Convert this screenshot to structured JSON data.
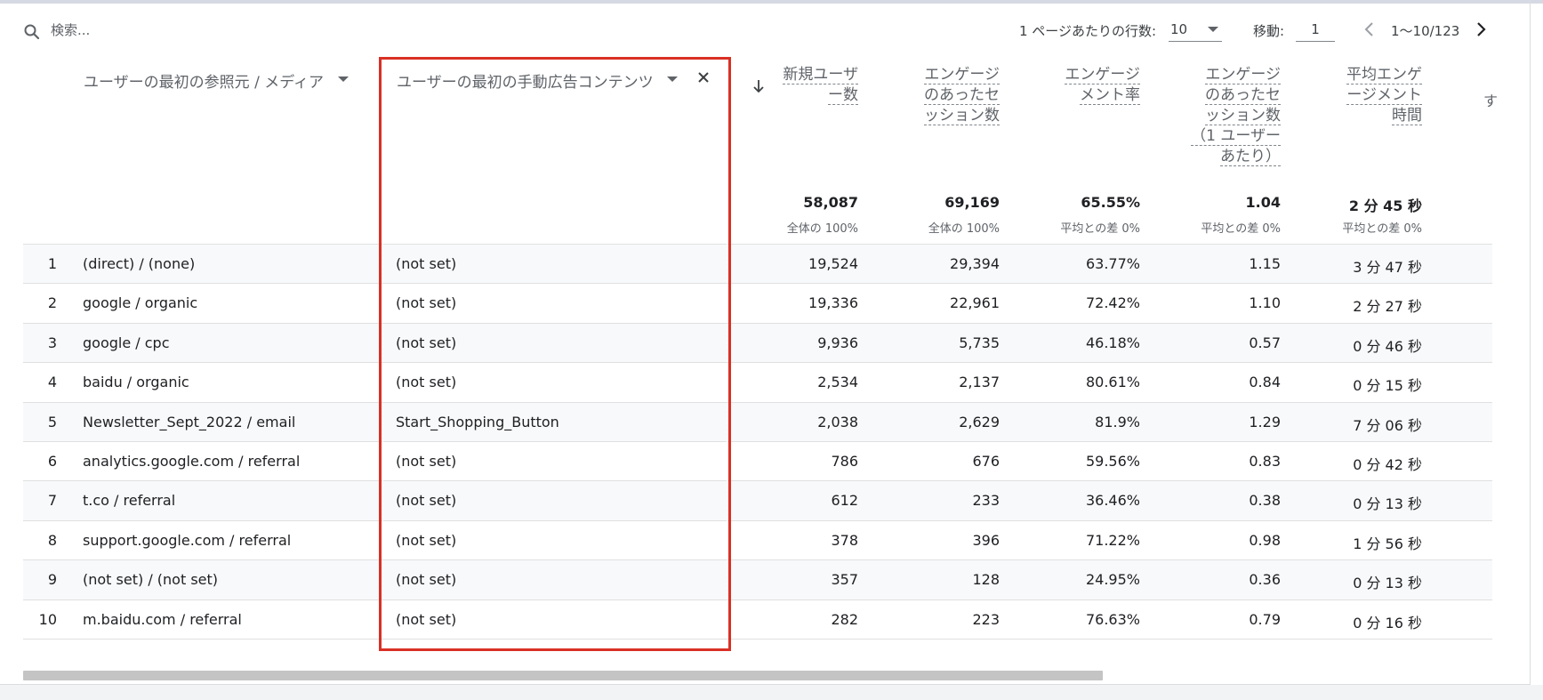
{
  "toolbar": {
    "search_placeholder": "検索...",
    "rows_per_page_label": "1 ページあたりの行数:",
    "rows_per_page_value": "10",
    "goto_label": "移動:",
    "goto_value": "1",
    "page_range": "1～10/123"
  },
  "header": {
    "dimension1": "ユーザーの最初の参照元 / メディア",
    "dimension2": "ユーザーの最初の手動広告コンテンツ",
    "more": "す",
    "metrics": [
      {
        "lines": [
          "新規ユーザ",
          "ー数"
        ],
        "total": "58,087",
        "sub": "全体の 100%"
      },
      {
        "lines": [
          "エンゲージ",
          "のあったセ",
          "ッション数"
        ],
        "total": "69,169",
        "sub": "全体の 100%"
      },
      {
        "lines": [
          "エンゲージ",
          "メント率"
        ],
        "total": "65.55%",
        "sub": "平均との差 0%"
      },
      {
        "lines": [
          "エンゲージ",
          "のあったセ",
          "ッション数",
          "（1 ユーザー",
          "あたり）"
        ],
        "total": "1.04",
        "sub": "平均との差 0%"
      },
      {
        "lines": [
          "平均エンゲ",
          "ージメント",
          "時間"
        ],
        "total": "2 分 45 秒",
        "sub": "平均との差 0%"
      }
    ]
  },
  "rows": [
    {
      "idx": "1",
      "source": "(direct) / (none)",
      "content": "(not set)",
      "new_users": "19,524",
      "engaged_sessions": "29,394",
      "engagement_rate": "63.77%",
      "per_user": "1.15",
      "avg_time": "3 分 47 秒"
    },
    {
      "idx": "2",
      "source": "google / organic",
      "content": "(not set)",
      "new_users": "19,336",
      "engaged_sessions": "22,961",
      "engagement_rate": "72.42%",
      "per_user": "1.10",
      "avg_time": "2 分 27 秒"
    },
    {
      "idx": "3",
      "source": "google / cpc",
      "content": "(not set)",
      "new_users": "9,936",
      "engaged_sessions": "5,735",
      "engagement_rate": "46.18%",
      "per_user": "0.57",
      "avg_time": "0 分 46 秒"
    },
    {
      "idx": "4",
      "source": "baidu / organic",
      "content": "(not set)",
      "new_users": "2,534",
      "engaged_sessions": "2,137",
      "engagement_rate": "80.61%",
      "per_user": "0.84",
      "avg_time": "0 分 15 秒"
    },
    {
      "idx": "5",
      "source": "Newsletter_Sept_2022 / email",
      "content": "Start_Shopping_Button",
      "new_users": "2,038",
      "engaged_sessions": "2,629",
      "engagement_rate": "81.9%",
      "per_user": "1.29",
      "avg_time": "7 分 06 秒"
    },
    {
      "idx": "6",
      "source": "analytics.google.com / referral",
      "content": "(not set)",
      "new_users": "786",
      "engaged_sessions": "676",
      "engagement_rate": "59.56%",
      "per_user": "0.83",
      "avg_time": "0 分 42 秒"
    },
    {
      "idx": "7",
      "source": "t.co / referral",
      "content": "(not set)",
      "new_users": "612",
      "engaged_sessions": "233",
      "engagement_rate": "36.46%",
      "per_user": "0.38",
      "avg_time": "0 分 13 秒"
    },
    {
      "idx": "8",
      "source": "support.google.com / referral",
      "content": "(not set)",
      "new_users": "378",
      "engaged_sessions": "396",
      "engagement_rate": "71.22%",
      "per_user": "0.98",
      "avg_time": "1 分 56 秒"
    },
    {
      "idx": "9",
      "source": "(not set) / (not set)",
      "content": "(not set)",
      "new_users": "357",
      "engaged_sessions": "128",
      "engagement_rate": "24.95%",
      "per_user": "0.36",
      "avg_time": "0 分 13 秒"
    },
    {
      "idx": "10",
      "source": "m.baidu.com / referral",
      "content": "(not set)",
      "new_users": "282",
      "engaged_sessions": "223",
      "engagement_rate": "76.63%",
      "per_user": "0.79",
      "avg_time": "0 分 16 秒"
    }
  ],
  "colors": {
    "selection": "#d93025",
    "row_shade": "#f8f9fa"
  }
}
